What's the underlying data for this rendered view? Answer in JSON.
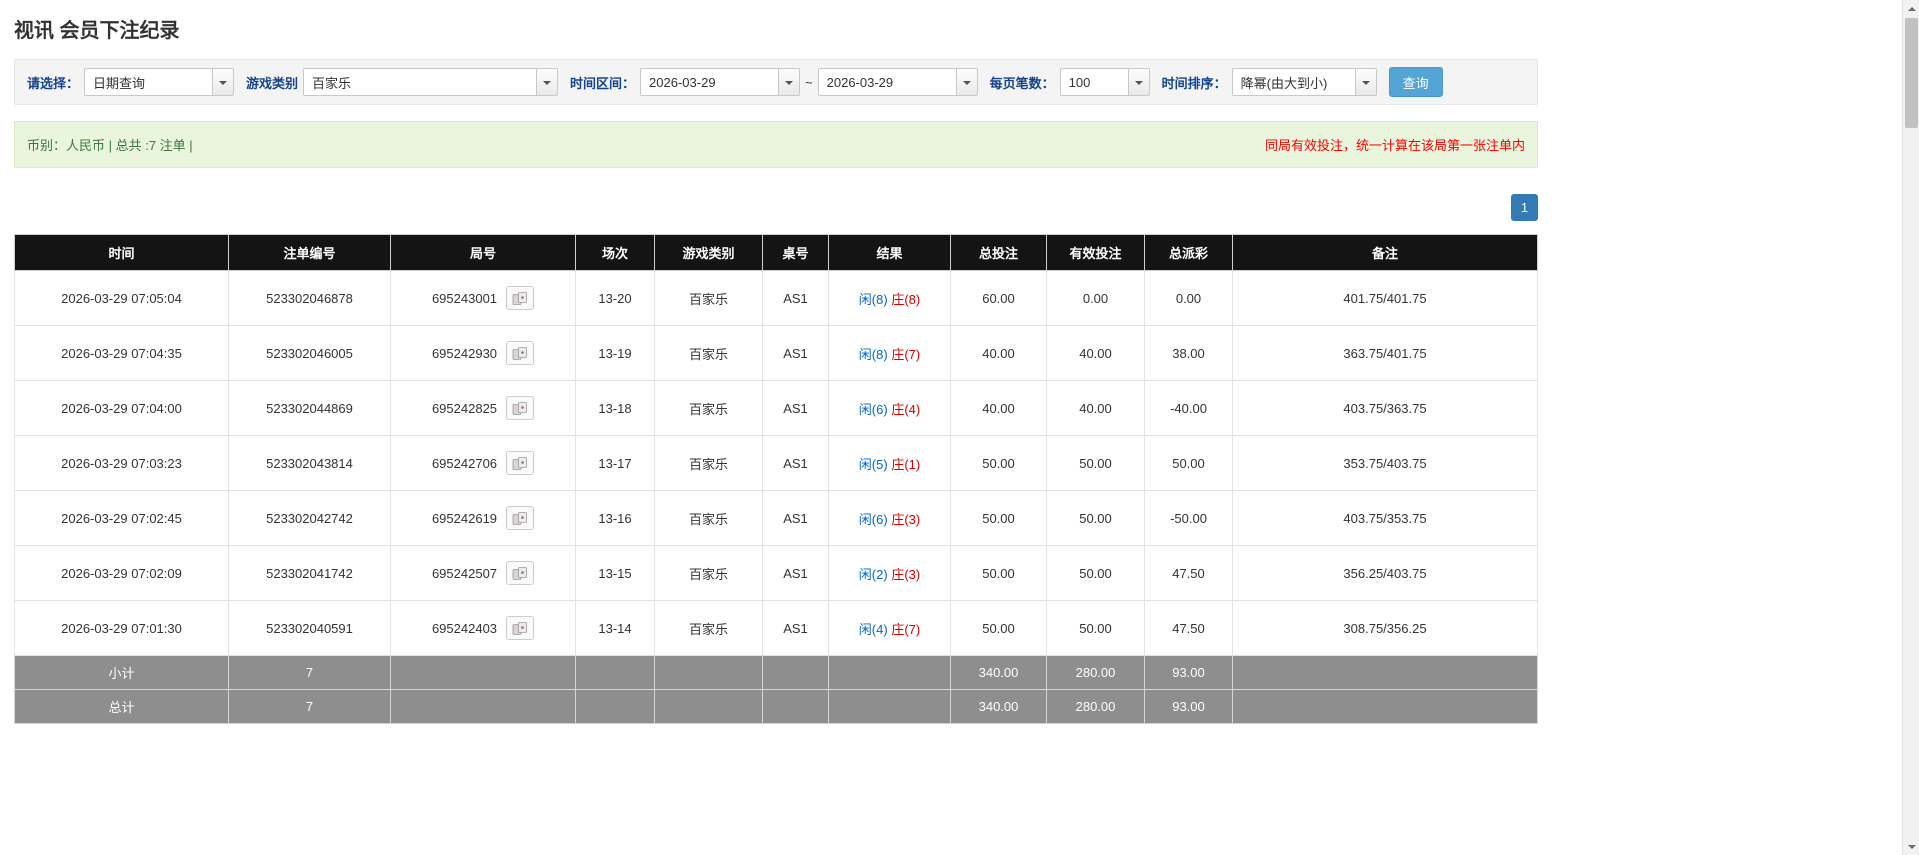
{
  "page": {
    "title": "视讯 会员下注纪录"
  },
  "filters": {
    "select_label": "请选择：",
    "select_value": "日期查询",
    "game_label": "游戏类别",
    "game_value": "百家乐",
    "range_label": "时间区间：",
    "date_from": "2026-03-29",
    "tilde": "~",
    "date_to": "2026-03-29",
    "per_page_label": "每页笔数：",
    "per_page_value": "100",
    "sort_label": "时间排序：",
    "sort_value": "降幂(由大到小)",
    "search_button": "查询"
  },
  "summary": {
    "left": "币别：人民币 | 总共 :7 注单 |",
    "right": "同局有效投注，统一计算在该局第一张注单内"
  },
  "pagination": {
    "current": "1"
  },
  "table": {
    "headers": [
      "时间",
      "注单编号",
      "局号",
      "场次",
      "游戏类别",
      "桌号",
      "结果",
      "总投注",
      "有效投注",
      "总派彩",
      "备注"
    ],
    "rows": [
      {
        "time": "2026-03-29 07:05:04",
        "bet_id": "523302046878",
        "round_no": "695243001",
        "session": "13-20",
        "game": "百家乐",
        "table_no": "AS1",
        "result_player": "闲(8)",
        "result_banker": "庄(8)",
        "total_bet": "60.00",
        "valid_bet": "0.00",
        "payout": "0.00",
        "remark": "401.75/401.75"
      },
      {
        "time": "2026-03-29 07:04:35",
        "bet_id": "523302046005",
        "round_no": "695242930",
        "session": "13-19",
        "game": "百家乐",
        "table_no": "AS1",
        "result_player": "闲(8)",
        "result_banker": "庄(7)",
        "total_bet": "40.00",
        "valid_bet": "40.00",
        "payout": "38.00",
        "remark": "363.75/401.75"
      },
      {
        "time": "2026-03-29 07:04:00",
        "bet_id": "523302044869",
        "round_no": "695242825",
        "session": "13-18",
        "game": "百家乐",
        "table_no": "AS1",
        "result_player": "闲(6)",
        "result_banker": "庄(4)",
        "total_bet": "40.00",
        "valid_bet": "40.00",
        "payout": "-40.00",
        "remark": "403.75/363.75"
      },
      {
        "time": "2026-03-29 07:03:23",
        "bet_id": "523302043814",
        "round_no": "695242706",
        "session": "13-17",
        "game": "百家乐",
        "table_no": "AS1",
        "result_player": "闲(5)",
        "result_banker": "庄(1)",
        "total_bet": "50.00",
        "valid_bet": "50.00",
        "payout": "50.00",
        "remark": "353.75/403.75"
      },
      {
        "time": "2026-03-29 07:02:45",
        "bet_id": "523302042742",
        "round_no": "695242619",
        "session": "13-16",
        "game": "百家乐",
        "table_no": "AS1",
        "result_player": "闲(6)",
        "result_banker": "庄(3)",
        "total_bet": "50.00",
        "valid_bet": "50.00",
        "payout": "-50.00",
        "remark": "403.75/353.75"
      },
      {
        "time": "2026-03-29 07:02:09",
        "bet_id": "523302041742",
        "round_no": "695242507",
        "session": "13-15",
        "game": "百家乐",
        "table_no": "AS1",
        "result_player": "闲(2)",
        "result_banker": "庄(3)",
        "total_bet": "50.00",
        "valid_bet": "50.00",
        "payout": "47.50",
        "remark": "356.25/403.75"
      },
      {
        "time": "2026-03-29 07:01:30",
        "bet_id": "523302040591",
        "round_no": "695242403",
        "session": "13-14",
        "game": "百家乐",
        "table_no": "AS1",
        "result_player": "闲(4)",
        "result_banker": "庄(7)",
        "total_bet": "50.00",
        "valid_bet": "50.00",
        "payout": "47.50",
        "remark": "308.75/356.25"
      }
    ],
    "subtotal": {
      "label": "小计",
      "count": "7",
      "total_bet": "340.00",
      "valid_bet": "280.00",
      "payout": "93.00"
    },
    "total": {
      "label": "总计",
      "count": "7",
      "total_bet": "340.00",
      "valid_bet": "280.00",
      "payout": "93.00"
    }
  },
  "colors": {
    "accent_blue": "#337ab7",
    "button_blue": "#54a5d6",
    "header_bg": "#141414",
    "footer_bg": "#8e8e8e",
    "summary_bg": "#e9f5dc",
    "negative_red": "#e00000",
    "player_blue": "#0066cc",
    "banker_red": "#d40000",
    "note_red": "#ff0000",
    "label_blue": "#15428b"
  }
}
